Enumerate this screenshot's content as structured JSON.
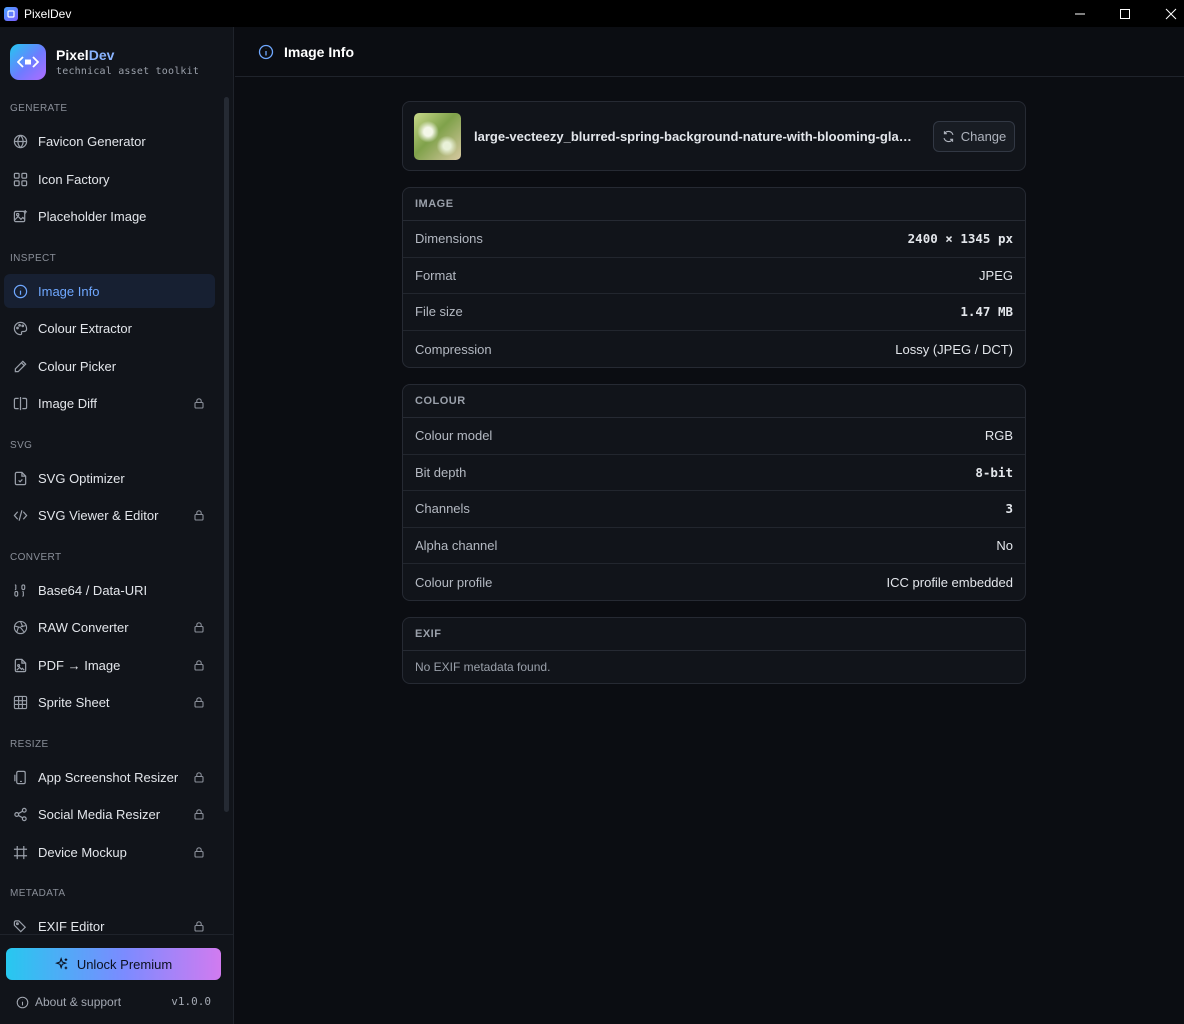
{
  "window": {
    "title": "PixelDev"
  },
  "brand": {
    "name_main": "Pixel",
    "name_accent": "Dev",
    "tagline": "technical asset toolkit"
  },
  "sidebar": {
    "sections": [
      {
        "label": "GENERATE"
      },
      {
        "label": "INSPECT"
      },
      {
        "label": "SVG"
      },
      {
        "label": "CONVERT"
      },
      {
        "label": "RESIZE"
      },
      {
        "label": "METADATA"
      }
    ],
    "items": [
      {
        "label": "Favicon Generator",
        "icon": "globe-icon",
        "locked": false
      },
      {
        "label": "Icon Factory",
        "icon": "grid-icon",
        "locked": false
      },
      {
        "label": "Placeholder Image",
        "icon": "image-plus-icon",
        "locked": false
      },
      {
        "label": "Image Info",
        "icon": "info-icon",
        "locked": false,
        "active": true
      },
      {
        "label": "Colour Extractor",
        "icon": "palette-icon",
        "locked": false
      },
      {
        "label": "Colour Picker",
        "icon": "eyedropper-icon",
        "locked": false
      },
      {
        "label": "Image Diff",
        "icon": "split-icon",
        "locked": true
      },
      {
        "label": "SVG Optimizer",
        "icon": "file-icon",
        "locked": false
      },
      {
        "label": "SVG Viewer & Editor",
        "icon": "code-icon",
        "locked": true
      },
      {
        "label": "Base64 / Data-URI",
        "icon": "binary-icon",
        "locked": false
      },
      {
        "label": "RAW Converter",
        "icon": "aperture-icon",
        "locked": true
      },
      {
        "label": "PDF → Image",
        "icon": "file-image-icon",
        "locked": true
      },
      {
        "label": "Sprite Sheet",
        "icon": "sprite-grid-icon",
        "locked": true
      },
      {
        "label": "App Screenshot Resizer",
        "icon": "phone-icon",
        "locked": true
      },
      {
        "label": "Social Media Resizer",
        "icon": "share-icon",
        "locked": true
      },
      {
        "label": "Device Mockup",
        "icon": "frame-icon",
        "locked": true
      },
      {
        "label": "EXIF Editor",
        "icon": "tag-icon",
        "locked": true
      }
    ],
    "premium_label": "Unlock Premium",
    "about_label": "About & support",
    "version": "v1.0.0"
  },
  "header": {
    "title": "Image Info"
  },
  "file": {
    "name": "large-vecteezy_blurred-spring-background-nature-with-blooming-glade_...",
    "change_label": "Change"
  },
  "image_section": {
    "title": "IMAGE",
    "rows": [
      {
        "key": "Dimensions",
        "value": "2400 × 1345 px"
      },
      {
        "key": "Format",
        "value": "JPEG"
      },
      {
        "key": "File size",
        "value": "1.47 MB"
      },
      {
        "key": "Compression",
        "value": "Lossy (JPEG / DCT)"
      }
    ]
  },
  "colour_section": {
    "title": "COLOUR",
    "rows": [
      {
        "key": "Colour model",
        "value": "RGB"
      },
      {
        "key": "Bit depth",
        "value": "8-bit"
      },
      {
        "key": "Channels",
        "value": "3"
      },
      {
        "key": "Alpha channel",
        "value": "No"
      },
      {
        "key": "Colour profile",
        "value": "ICC profile embedded"
      }
    ]
  },
  "exif_section": {
    "title": "EXIF",
    "empty_text": "No EXIF metadata found."
  },
  "colors": {
    "accent": "#6fa8ff",
    "background": "#0b0d12",
    "sidebar": "#11141a",
    "card": "#11141a"
  }
}
